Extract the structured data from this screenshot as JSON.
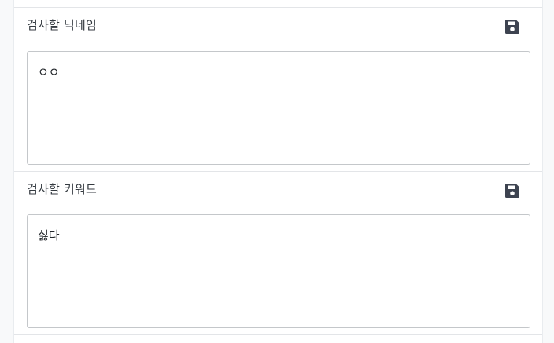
{
  "sections": [
    {
      "label": "검사할 닉네임",
      "value": "ㅇㅇ",
      "save_icon": "floppy-disk-icon"
    },
    {
      "label": "검사할 키워드",
      "value": "싫다",
      "save_icon": "floppy-disk-icon"
    }
  ],
  "colors": {
    "icon": "#3d4350",
    "border": "#c4c7ca",
    "page_bg": "#f8f9fa"
  }
}
